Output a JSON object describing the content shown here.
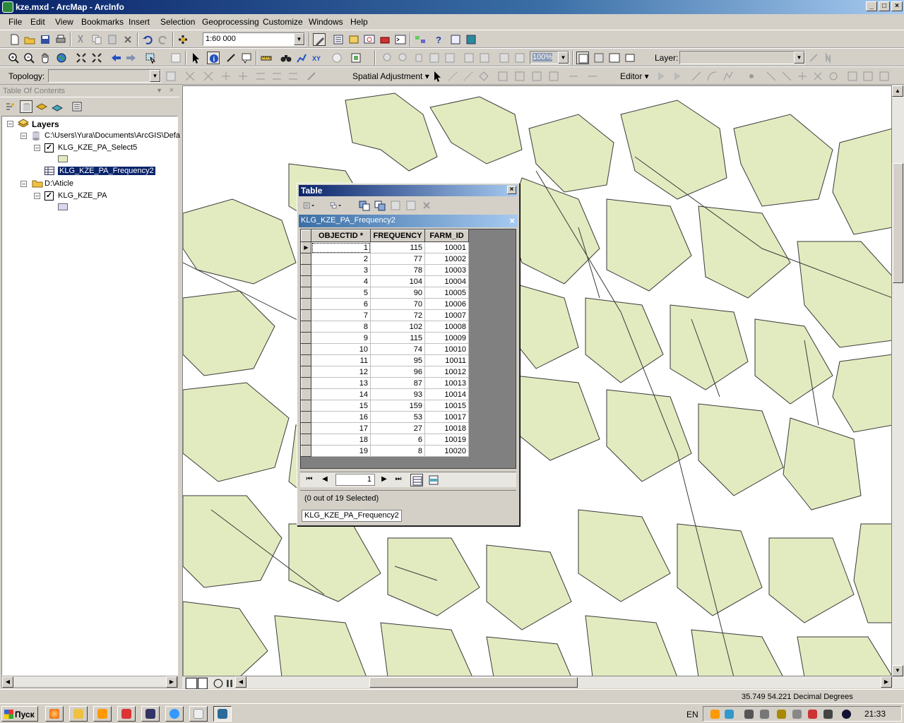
{
  "window": {
    "title": "kze.mxd - ArcMap - ArcInfo"
  },
  "menu": [
    "File",
    "Edit",
    "View",
    "Bookmarks",
    "Insert",
    "Selection",
    "Geoprocessing",
    "Customize",
    "Windows",
    "Help"
  ],
  "toolbar": {
    "scale": "1:60 000",
    "zoom_percent": "100%",
    "layer_label": "Layer:",
    "layer_value": "",
    "topology_label": "Topology:",
    "topology_value": "",
    "spatial_adjustment_label": "Spatial Adjustment ▾",
    "editor_label": "Editor ▾"
  },
  "toc": {
    "title": "Table Of Contents",
    "root": "Layers",
    "items": [
      {
        "label": "C:\\Users\\Yura\\Documents\\ArcGIS\\Defa",
        "kind": "folder-db"
      },
      {
        "label": "KLG_KZE_PA_Select5",
        "kind": "layer",
        "checked": true
      },
      {
        "label": "KLG_KZE_PA_Frequency2",
        "kind": "table",
        "selected": true
      },
      {
        "label": "D:\\Aticle",
        "kind": "folder"
      },
      {
        "label": "KLG_KZE_PA",
        "kind": "layer",
        "checked": true
      }
    ],
    "colors": {
      "select5_symbol": "#e2ebbf",
      "kze_pa_symbol": "#d8d8f0"
    }
  },
  "table_window": {
    "title": "Table",
    "tab_name": "KLG_KZE_PA_Frequency2",
    "columns": [
      "OBJECTID *",
      "FREQUENCY",
      "FARM_ID"
    ],
    "rows": [
      [
        "1",
        "115",
        "10001"
      ],
      [
        "2",
        "77",
        "10002"
      ],
      [
        "3",
        "78",
        "10003"
      ],
      [
        "4",
        "104",
        "10004"
      ],
      [
        "5",
        "90",
        "10005"
      ],
      [
        "6",
        "70",
        "10006"
      ],
      [
        "7",
        "72",
        "10007"
      ],
      [
        "8",
        "102",
        "10008"
      ],
      [
        "9",
        "115",
        "10009"
      ],
      [
        "10",
        "74",
        "10010"
      ],
      [
        "11",
        "95",
        "10011"
      ],
      [
        "12",
        "96",
        "10012"
      ],
      [
        "13",
        "87",
        "10013"
      ],
      [
        "14",
        "93",
        "10014"
      ],
      [
        "15",
        "159",
        "10015"
      ],
      [
        "16",
        "53",
        "10017"
      ],
      [
        "17",
        "27",
        "10018"
      ],
      [
        "18",
        "6",
        "10019"
      ],
      [
        "19",
        "8",
        "10020"
      ]
    ],
    "page": "1",
    "selection_status": "(0 out of 19 Selected)",
    "bottom_tab": "KLG_KZE_PA_Frequency2"
  },
  "status": {
    "coordinates": "35.749  54.221 Decimal Degrees"
  },
  "taskbar": {
    "start": "Пуск",
    "lang": "EN",
    "clock": "21:33"
  },
  "colors": {
    "map_fill": "#e2ebbf",
    "map_stroke": "#3a3a3a",
    "title_blue": "#0a246a"
  }
}
